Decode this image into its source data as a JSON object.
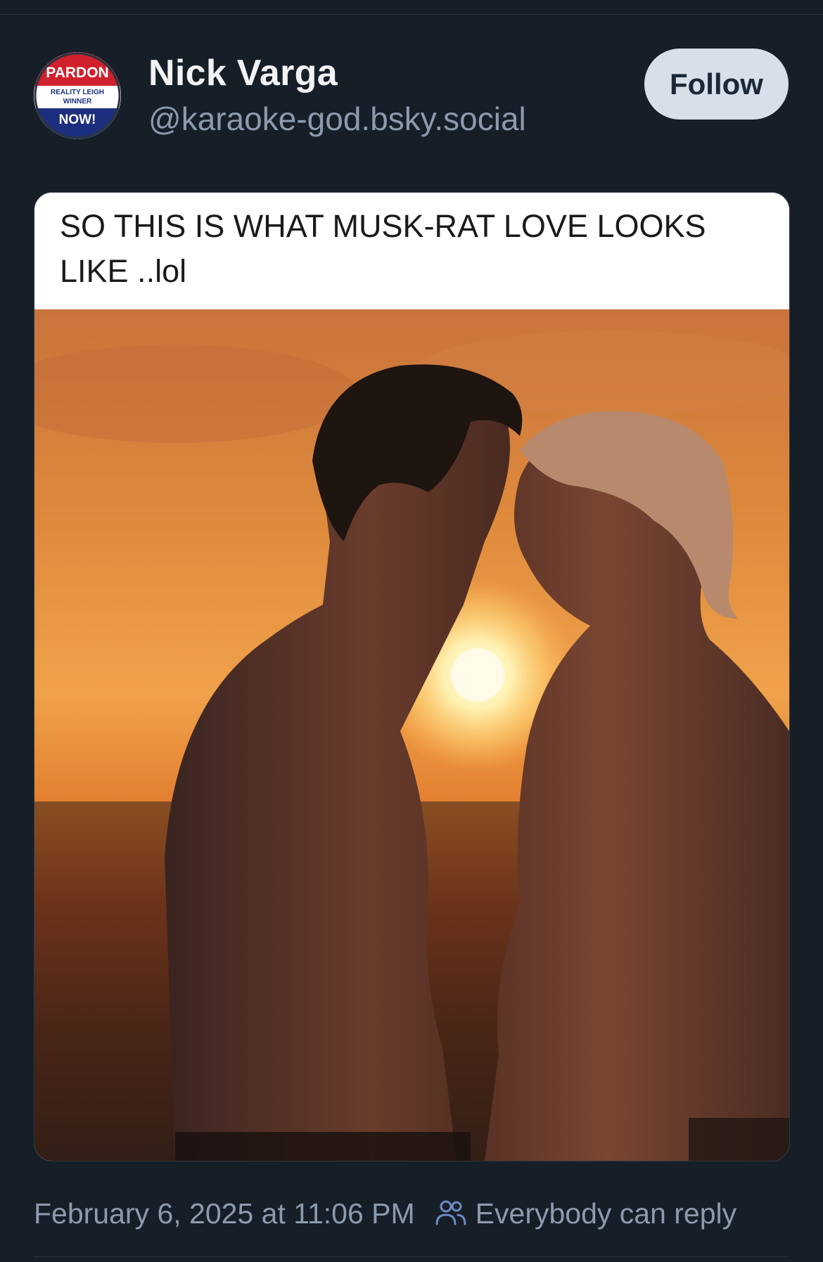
{
  "post": {
    "author": {
      "display_name": "Nick Varga",
      "handle": "@karaoke-god.bsky.social",
      "avatar_badge": {
        "top": "PARDON",
        "middle_line1": "REALITY LEIGH",
        "middle_line2": "WINNER",
        "bottom": "NOW!"
      }
    },
    "follow_label": "Follow",
    "image_caption": "SO THIS IS WHAT MUSK-RAT LOVE LOOKS LIKE ..lol",
    "timestamp": "February 6, 2025 at 11:06 PM",
    "reply_setting": "Everybody can reply",
    "reply_icon": "people-icon"
  },
  "colors": {
    "background": "#161e27",
    "text_primary": "#f1f3f5",
    "text_muted": "#8c9bac",
    "follow_button_bg": "#d7dfe8",
    "follow_button_text": "#1b2836"
  }
}
